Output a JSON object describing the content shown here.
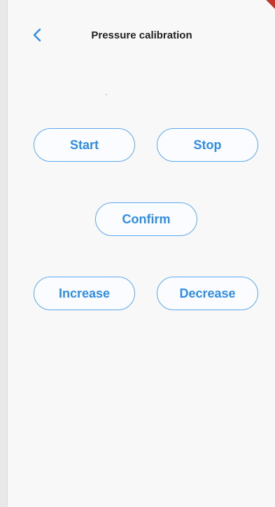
{
  "header": {
    "title": "Pressure calibration",
    "back_icon": "chevron-left-icon"
  },
  "buttons": {
    "start": "Start",
    "stop": "Stop",
    "confirm": "Confirm",
    "increase": "Increase",
    "decrease": "Decrease"
  },
  "colors": {
    "accent": "#2f8de6",
    "button_border": "#5aa8ef",
    "background": "#f8f8f8",
    "title_text": "#222222"
  }
}
